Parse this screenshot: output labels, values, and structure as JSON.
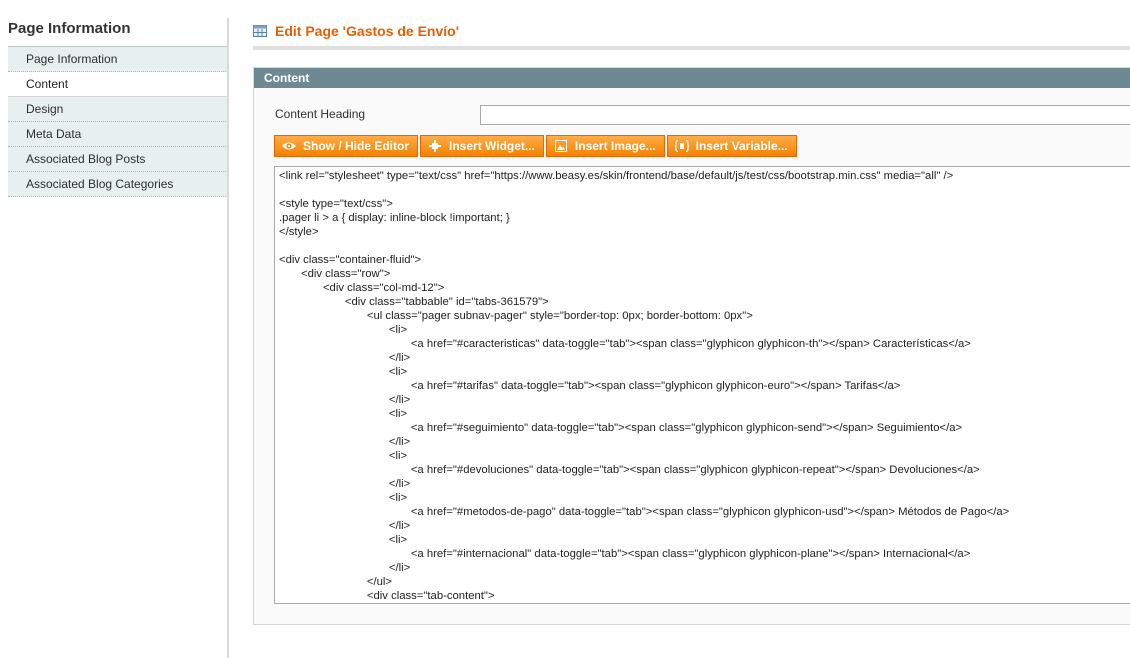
{
  "sidebar": {
    "title": "Page Information",
    "items": [
      {
        "label": "Page Information",
        "active": false
      },
      {
        "label": "Content",
        "active": true
      },
      {
        "label": "Design",
        "active": false
      },
      {
        "label": "Meta Data",
        "active": false
      },
      {
        "label": "Associated Blog Posts",
        "active": false
      },
      {
        "label": "Associated Blog Categories",
        "active": false
      }
    ]
  },
  "header": {
    "title": "Edit Page 'Gastos de Envío'"
  },
  "content": {
    "section_title": "Content",
    "heading_label": "Content Heading",
    "heading_value": "",
    "buttons": {
      "show_hide": "Show / Hide Editor",
      "insert_widget": "Insert Widget...",
      "insert_image": "Insert Image...",
      "insert_variable": "Insert Variable..."
    },
    "code_lines": [
      "<link rel=\"stylesheet\" type=\"text/css\" href=\"https://www.beasy.es/skin/frontend/base/default/js/test/css/bootstrap.min.css\" media=\"all\" />",
      "",
      "<style type=\"text/css\">",
      ".pager li > a { display: inline-block !important; }",
      "</style>",
      "",
      "<div class=\"container-fluid\">",
      "\t<div class=\"row\">",
      "\t\t<div class=\"col-md-12\">",
      "\t\t\t<div class=\"tabbable\" id=\"tabs-361579\">",
      "\t\t\t\t<ul class=\"pager subnav-pager\" style=\"border-top: 0px; border-bottom: 0px\">",
      "\t\t\t\t\t<li>",
      "\t\t\t\t\t\t<a href=\"#caracteristicas\" data-toggle=\"tab\"><span class=\"glyphicon glyphicon-th\"></span> Características</a>",
      "\t\t\t\t\t</li>",
      "\t\t\t\t\t<li>",
      "\t\t\t\t\t\t<a href=\"#tarifas\" data-toggle=\"tab\"><span class=\"glyphicon glyphicon-euro\"></span> Tarifas</a>",
      "\t\t\t\t\t</li>",
      "\t\t\t\t\t<li>",
      "\t\t\t\t\t\t<a href=\"#seguimiento\" data-toggle=\"tab\"><span class=\"glyphicon glyphicon-send\"></span> Seguimiento</a>",
      "\t\t\t\t\t</li>",
      "\t\t\t\t\t<li>",
      "\t\t\t\t\t\t<a href=\"#devoluciones\" data-toggle=\"tab\"><span class=\"glyphicon glyphicon-repeat\"></span> Devoluciones</a>",
      "\t\t\t\t\t</li>",
      "\t\t\t\t\t<li>",
      "\t\t\t\t\t\t<a href=\"#metodos-de-pago\" data-toggle=\"tab\"><span class=\"glyphicon glyphicon-usd\"></span> Métodos de Pago</a>",
      "\t\t\t\t\t</li>",
      "\t\t\t\t\t<li>",
      "\t\t\t\t\t\t<a href=\"#internacional\" data-toggle=\"tab\"><span class=\"glyphicon glyphicon-plane\"></span> Internacional</a>",
      "\t\t\t\t\t</li>",
      "\t\t\t\t</ul>",
      "\t\t\t\t<div class=\"tab-content\">"
    ]
  },
  "colors": {
    "accent": "#eb5e00",
    "button": "#f18200",
    "section_header": "#6f8992",
    "sidebar_bg": "#e7efef"
  }
}
